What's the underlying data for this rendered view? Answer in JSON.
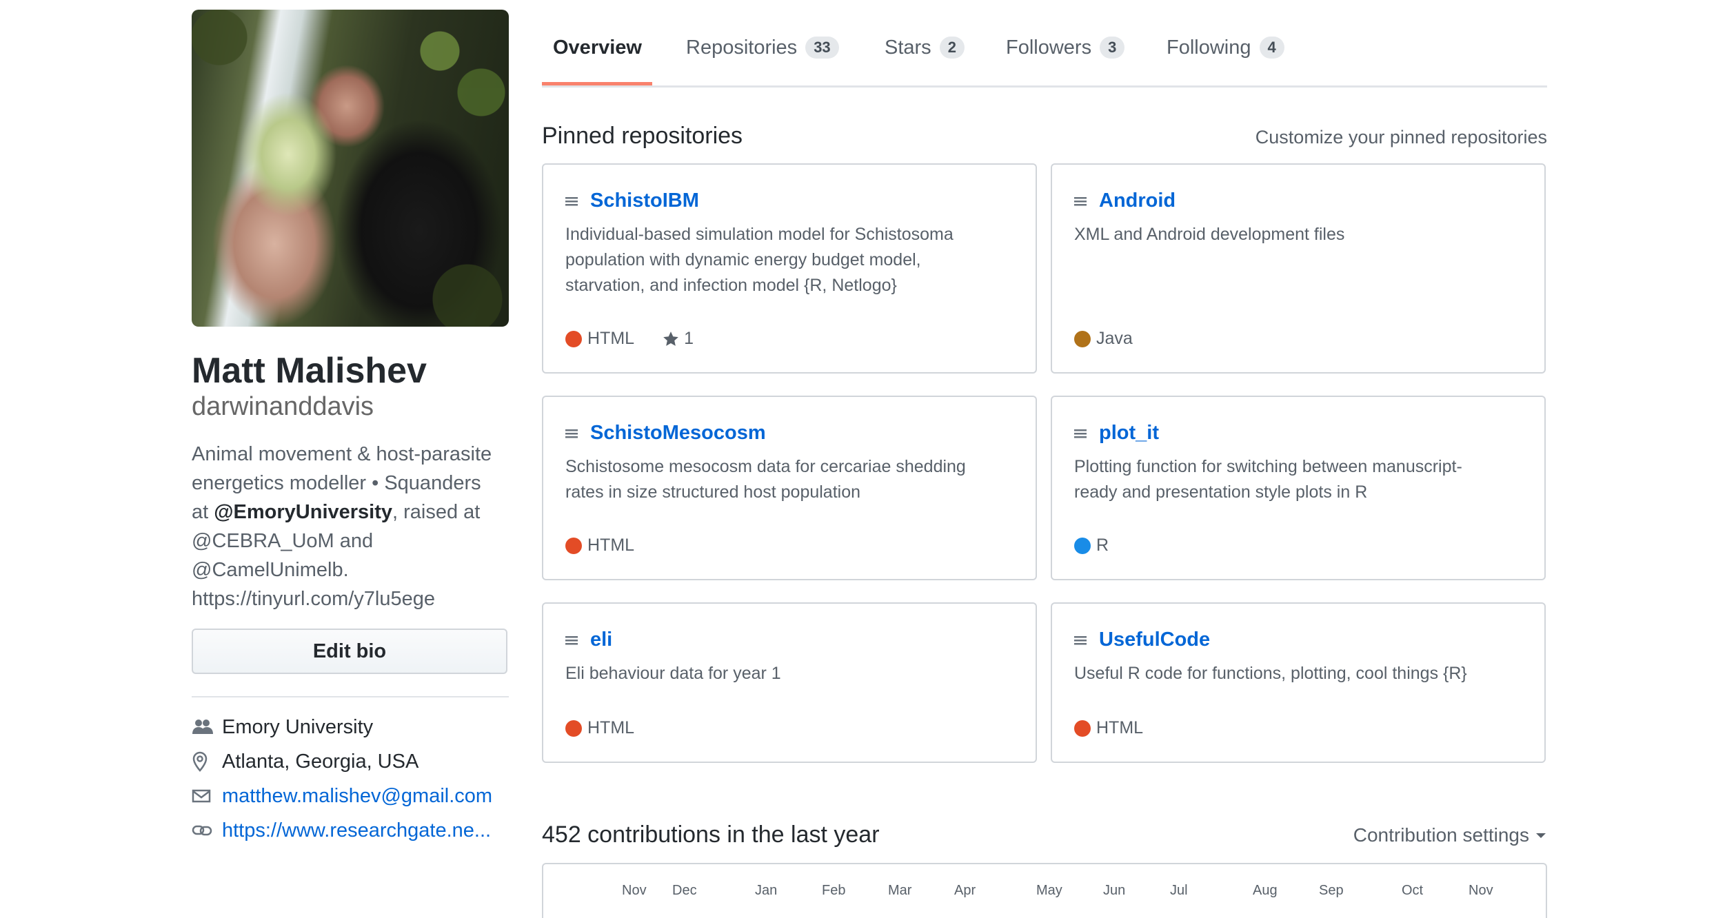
{
  "profile": {
    "name": "Matt Malishev",
    "username": "darwinanddavis",
    "bio": {
      "line1": "Animal movement & host-parasite",
      "line2": "energetics modeller • Squanders",
      "line3_prefix": "at ",
      "line3_org": "@EmoryUniversity",
      "line3_suffix": ", raised at",
      "line4": "@CEBRA_UoM and",
      "line5": "@CamelUnimelb.",
      "line6": "https://tinyurl.com/y7lu5ege"
    },
    "edit_bio_label": "Edit bio",
    "company": "Emory University",
    "location": "Atlanta, Georgia, USA",
    "email": "matthew.malishev@gmail.com",
    "website": "https://www.researchgate.ne..."
  },
  "tabs": [
    {
      "label": "Overview",
      "count": null
    },
    {
      "label": "Repositories",
      "count": "33"
    },
    {
      "label": "Stars",
      "count": "2"
    },
    {
      "label": "Followers",
      "count": "3"
    },
    {
      "label": "Following",
      "count": "4"
    }
  ],
  "pinned": {
    "title": "Pinned repositories",
    "customize_label": "Customize your pinned repositories",
    "repos": [
      {
        "name": "SchistoIBM",
        "desc_lines": [
          "Individual-based simulation model for Schistosoma",
          "population with dynamic energy budget model,",
          "starvation, and infection model {R, Netlogo}"
        ],
        "language": "HTML",
        "lang_color": "#e34c26",
        "stars": "1"
      },
      {
        "name": "Android",
        "desc_lines": [
          "XML and Android development files"
        ],
        "language": "Java",
        "lang_color": "#b07219"
      },
      {
        "name": "SchistoMesocosm",
        "desc_lines": [
          "Schistosome mesocosm data for cercariae shedding",
          "rates in size structured host population"
        ],
        "language": "HTML",
        "lang_color": "#e34c26"
      },
      {
        "name": "plot_it",
        "desc_lines": [
          "Plotting function for switching between manuscript-",
          "ready and presentation style plots in R"
        ],
        "language": "R",
        "lang_color": "#198ce7"
      },
      {
        "name": "eli",
        "desc_lines": [
          "Eli behaviour data for year 1"
        ],
        "language": "HTML",
        "lang_color": "#e34c26"
      },
      {
        "name": "UsefulCode",
        "desc_lines": [
          "Useful R code for functions, plotting, cool things {R}"
        ],
        "language": "HTML",
        "lang_color": "#e34c26"
      }
    ]
  },
  "contributions": {
    "title": "452 contributions in the last year",
    "settings_label": "Contribution settings",
    "months": [
      "Nov",
      "Dec",
      "Jan",
      "Feb",
      "Mar",
      "Apr",
      "May",
      "Jun",
      "Jul",
      "Aug",
      "Sep",
      "Oct",
      "Nov"
    ]
  }
}
